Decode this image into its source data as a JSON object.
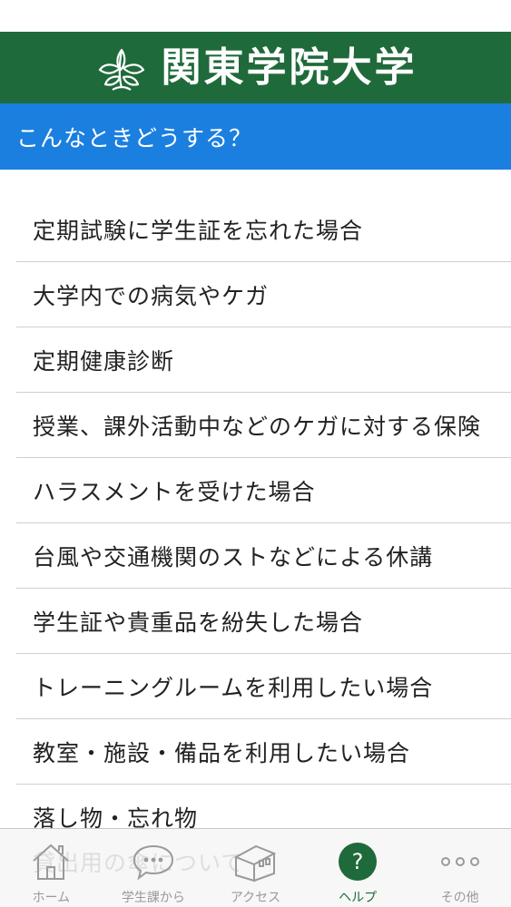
{
  "header": {
    "title": "関東学院大学"
  },
  "subheader": {
    "title": "こんなときどうする？"
  },
  "list": [
    "定期試験に学生証を忘れた場合",
    "大学内での病気やケガ",
    "定期健康診断",
    "授業、課外活動中などのケガに対する保険",
    "ハラスメントを受けた場合",
    "台風や交通機関のストなどによる休講",
    "学生証や貴重品を紛失した場合",
    "トレーニングルームを利用したい場合",
    "教室・施設・備品を利用したい場合",
    "落し物・忘れ物",
    "貸出用の傘について"
  ],
  "tabs": [
    {
      "label": "ホーム",
      "icon": "home-icon"
    },
    {
      "label": "学生課から",
      "icon": "chat-bubble-icon"
    },
    {
      "label": "アクセス",
      "icon": "building-icon"
    },
    {
      "label": "ヘルプ",
      "icon": "help-icon",
      "active": true
    },
    {
      "label": "その他",
      "icon": "more-icon"
    }
  ],
  "colors": {
    "header": "#1f6a3a",
    "subheader": "#1b7fe0",
    "active_tab": "#1f6a3a"
  }
}
